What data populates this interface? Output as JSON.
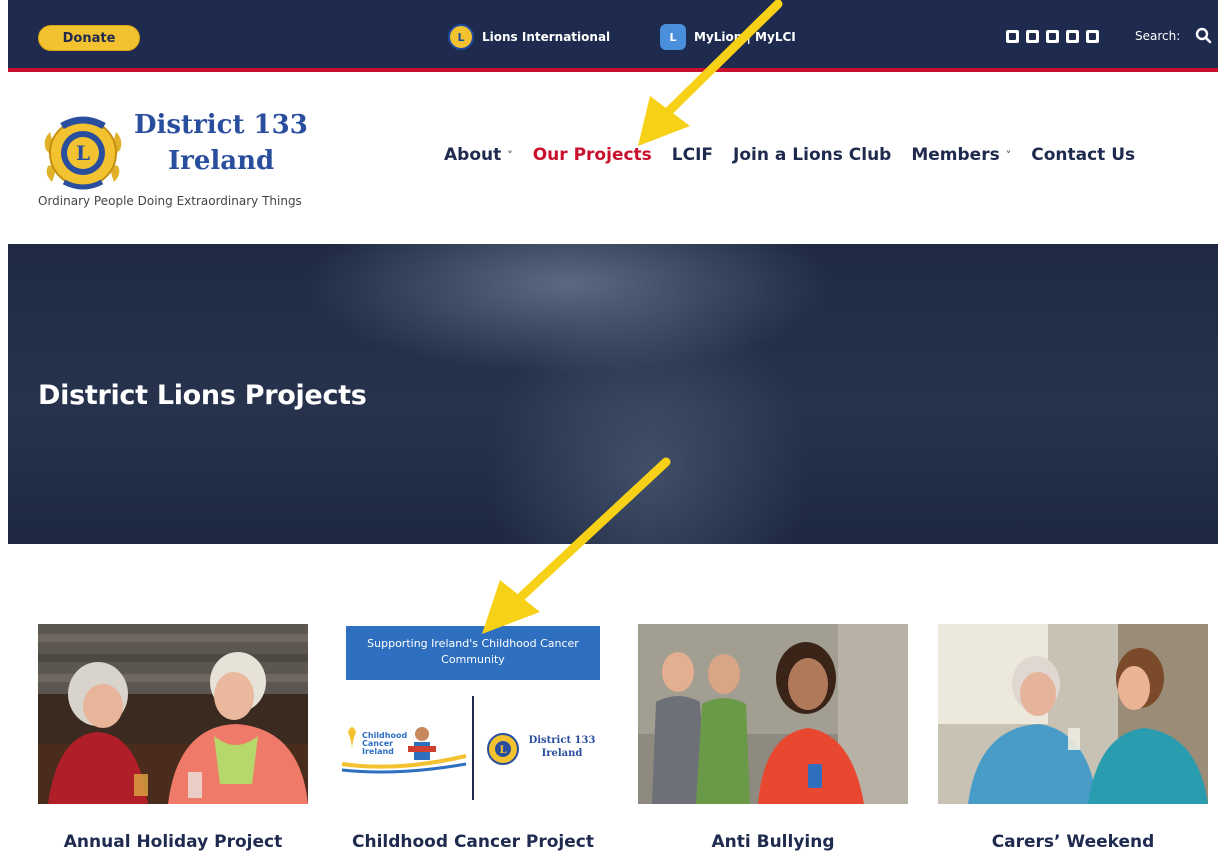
{
  "topbar": {
    "donate_label": "Donate",
    "lions_international": "Lions International",
    "mylion": "MyLion | MyLCI",
    "social_icons": [
      "facebook-icon",
      "twitter-icon",
      "instagram-icon",
      "youtube-icon",
      "linkedin-icon"
    ],
    "search_label": "Search:"
  },
  "header": {
    "brand_line1": "District 133",
    "brand_line2": "Ireland",
    "tagline": "Ordinary People Doing Extraordinary Things"
  },
  "nav": {
    "items": [
      {
        "label": "About",
        "has_dropdown": true,
        "active": false
      },
      {
        "label": "Our Projects",
        "has_dropdown": false,
        "active": true
      },
      {
        "label": "LCIF",
        "has_dropdown": false,
        "active": false
      },
      {
        "label": "Join a Lions Club",
        "has_dropdown": false,
        "active": false
      },
      {
        "label": "Members",
        "has_dropdown": true,
        "active": false
      },
      {
        "label": "Contact Us",
        "has_dropdown": false,
        "active": false
      }
    ]
  },
  "hero": {
    "title": "District Lions Projects"
  },
  "cards": [
    {
      "title": "Annual Holiday Project"
    },
    {
      "title": "Childhood Cancer Project",
      "banner": "Supporting Ireland's Childhood Cancer Community",
      "left_logo_text": "Childhood Cancer Ireland",
      "right_logo_text": "District 133 Ireland"
    },
    {
      "title": "Anti Bullying"
    },
    {
      "title": "Carers’ Weekend"
    }
  ],
  "colors": {
    "topbar": "#1e2a4e",
    "accent_red": "#c8102e",
    "donate_yellow": "#f2c230",
    "brand_blue": "#2a4e9e",
    "annotation_arrow": "#f7d117"
  }
}
